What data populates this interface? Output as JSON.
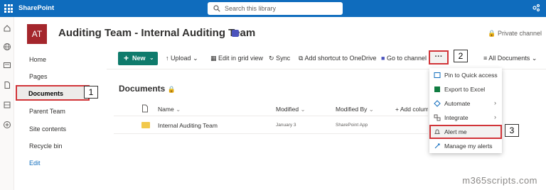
{
  "topbar": {
    "app_name": "SharePoint",
    "search_placeholder": "Search this library",
    "accent": "#0f6cbd"
  },
  "site": {
    "avatar_initials": "AT",
    "title": "Auditing Team - Internal Auditing Team",
    "privacy": "Private channel"
  },
  "nav": {
    "items": [
      {
        "label": "Home"
      },
      {
        "label": "Pages"
      },
      {
        "label": "Documents",
        "selected": true
      },
      {
        "label": "Parent Team"
      },
      {
        "label": "Site contents"
      },
      {
        "label": "Recycle bin"
      },
      {
        "label": "Edit"
      }
    ]
  },
  "commands": {
    "new": "New",
    "upload": "Upload",
    "grid": "Edit in grid view",
    "sync": "Sync",
    "shortcut": "Add shortcut to OneDrive",
    "channel": "Go to channel",
    "more": "···",
    "view": "All Documents"
  },
  "library": {
    "title": "Documents",
    "columns": [
      "Name",
      "Modified",
      "Modified By",
      "+ Add column"
    ],
    "rows": [
      {
        "name": "Internal Auditing Team",
        "modified": "January 3",
        "modified_by": "SharePoint App"
      }
    ]
  },
  "menu": {
    "items": [
      {
        "label": "Pin to Quick access",
        "icon": "pin-icon"
      },
      {
        "label": "Export to Excel",
        "icon": "excel-icon"
      },
      {
        "label": "Automate",
        "icon": "automate-icon",
        "submenu": true
      },
      {
        "label": "Integrate",
        "icon": "integrate-icon",
        "submenu": true
      },
      {
        "label": "Alert me",
        "icon": "bell-icon",
        "highlighted": true
      },
      {
        "label": "Manage my alerts",
        "icon": "manage-alerts-icon"
      }
    ]
  },
  "markers": {
    "m1": "1",
    "m2": "2",
    "m3": "3"
  },
  "watermark": "m365scripts.com",
  "colors": {
    "highlight": "#d13438",
    "new_button": "#0f7b6c",
    "avatar": "#a4262c"
  }
}
